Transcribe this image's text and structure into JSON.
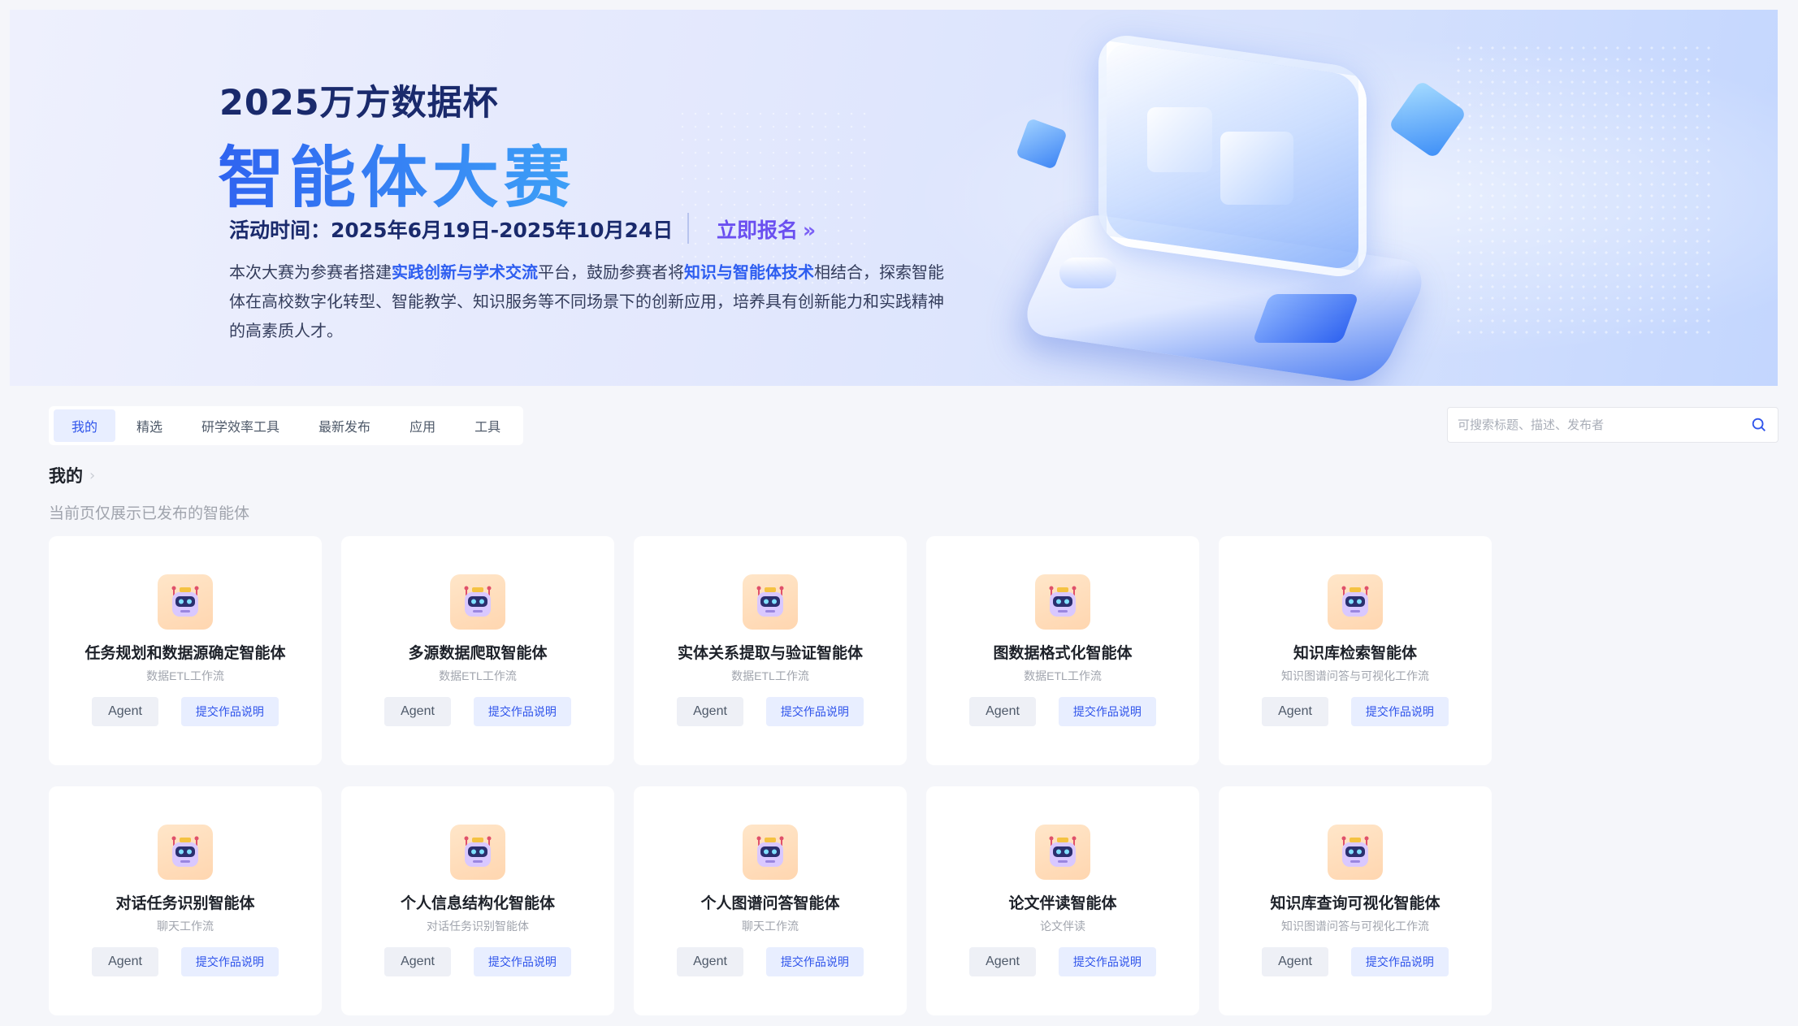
{
  "banner": {
    "subtitle": "2025万方数据杯",
    "title": "智能体大赛",
    "time": "活动时间：2025年6月19日-2025年10月24日",
    "signup": "立即报名",
    "signup_arrow": "»",
    "desc": {
      "p1": "本次大赛为参赛者搭建",
      "h1": "实践创新与学术交流",
      "p2": "平台，鼓励参赛者将",
      "h2": "知识与智能体技术",
      "p3": "相结合，探索智能体在高校数字化转型、智能教学、知识服务等不同场景下的创新应用，培养具有创新能力和实践精神的高素质人才。"
    }
  },
  "tabs": [
    {
      "label": "我的",
      "active": true
    },
    {
      "label": "精选"
    },
    {
      "label": "研学效率工具"
    },
    {
      "label": "最新发布"
    },
    {
      "label": "应用"
    },
    {
      "label": "工具"
    }
  ],
  "search": {
    "placeholder": "可搜索标题、描述、发布者"
  },
  "section": {
    "title": "我的",
    "chevron": "›",
    "note": "当前页仅展示已发布的智能体"
  },
  "cards": [
    {
      "title": "任务规划和数据源确定智能体",
      "sub": "数据ETL工作流",
      "tag": "Agent",
      "action": "提交作品说明"
    },
    {
      "title": "多源数据爬取智能体",
      "sub": "数据ETL工作流",
      "tag": "Agent",
      "action": "提交作品说明"
    },
    {
      "title": "实体关系提取与验证智能体",
      "sub": "数据ETL工作流",
      "tag": "Agent",
      "action": "提交作品说明"
    },
    {
      "title": "图数据格式化智能体",
      "sub": "数据ETL工作流",
      "tag": "Agent",
      "action": "提交作品说明"
    },
    {
      "title": "知识库检索智能体",
      "sub": "知识图谱问答与可视化工作流",
      "tag": "Agent",
      "action": "提交作品说明"
    },
    {
      "title": "对话任务识别智能体",
      "sub": "聊天工作流",
      "tag": "Agent",
      "action": "提交作品说明"
    },
    {
      "title": "个人信息结构化智能体",
      "sub": "对话任务识别智能体",
      "tag": "Agent",
      "action": "提交作品说明"
    },
    {
      "title": "个人图谱问答智能体",
      "sub": "聊天工作流",
      "tag": "Agent",
      "action": "提交作品说明"
    },
    {
      "title": "论文伴读智能体",
      "sub": "论文伴读",
      "tag": "Agent",
      "action": "提交作品说明"
    },
    {
      "title": "知识库查询可视化智能体",
      "sub": "知识图谱问答与可视化工作流",
      "tag": "Agent",
      "action": "提交作品说明"
    }
  ],
  "colors": {
    "accent": "#2f54eb",
    "banner_title": "#2f63f0",
    "signup": "#6a4ff0"
  },
  "icons": {
    "search": "search-icon",
    "agent_avatar": "robot-icon"
  }
}
